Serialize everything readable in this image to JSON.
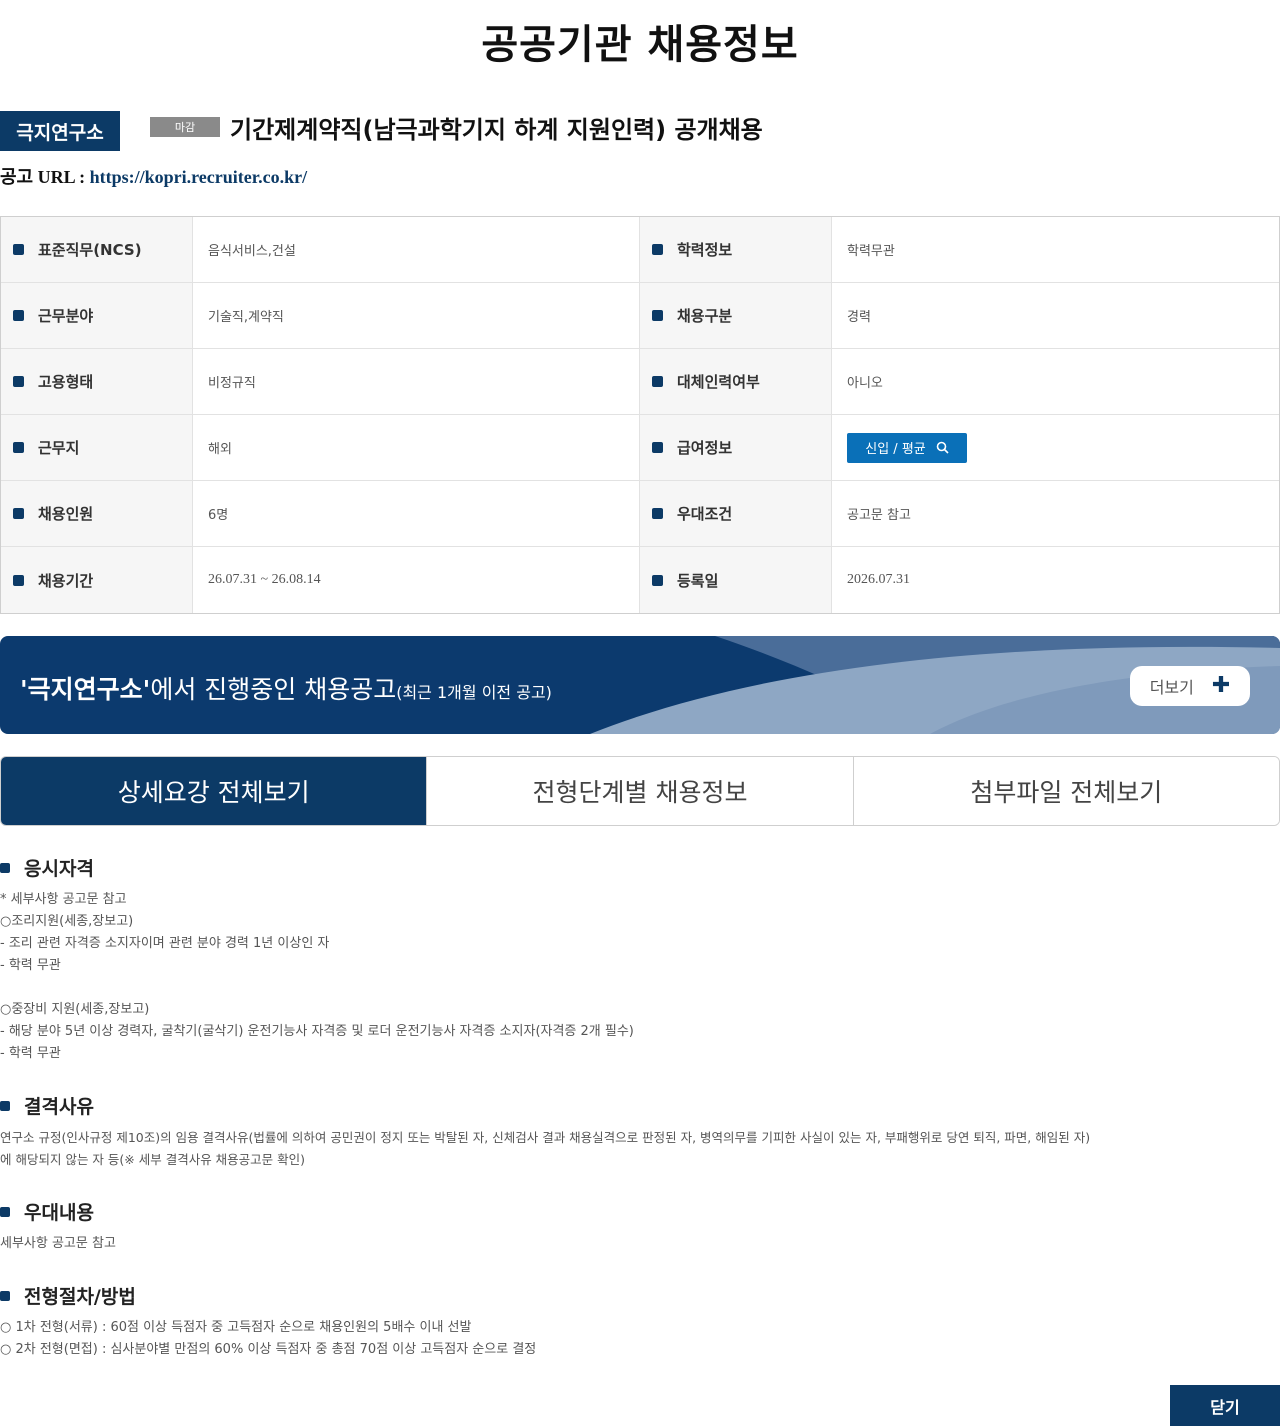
{
  "page": {
    "title": "공공기관 채용정보"
  },
  "posting": {
    "org": "극지연구소",
    "status_badge": "마감",
    "title": "기간제계약직(남극과학기지 하계 지원인력) 공개채용",
    "url_label": "공고 URL : ",
    "url": "https://kopri.recruiter.co.kr/"
  },
  "info": {
    "rows": [
      {
        "l_label": "표준직무(NCS)",
        "l_value": "음식서비스,건설",
        "r_label": "학력정보",
        "r_value": "학력무관"
      },
      {
        "l_label": "근무분야",
        "l_value": "기술직,계약직",
        "r_label": "채용구분",
        "r_value": "경력"
      },
      {
        "l_label": "고용형태",
        "l_value": "비정규직",
        "r_label": "대체인력여부",
        "r_value": "아니오"
      },
      {
        "l_label": "근무지",
        "l_value": "해외",
        "r_label": "급여정보",
        "r_value": ""
      },
      {
        "l_label": "채용인원",
        "l_value": "6명",
        "r_label": "우대조건",
        "r_value": "공고문 참고"
      },
      {
        "l_label": "채용기간",
        "l_value": "26.07.31 ~ 26.08.14",
        "r_label": "등록일",
        "r_value": "2026.07.31"
      }
    ],
    "salary_button": "신입 / 평균"
  },
  "banner": {
    "org_quoted": "'극지연구소'",
    "text": "에서 진행중인 채용공고",
    "small": "(최근 1개월 이전 공고)",
    "more_label": "더보기"
  },
  "tabs": [
    "상세요강 전체보기",
    "전형단계별 채용정보",
    "첨부파일 전체보기"
  ],
  "sections": {
    "qualification": {
      "title": "응시자격",
      "body": "* 세부사항 공고문 참고\n○조리지원(세종,장보고)\n- 조리 관련 자격증 소지자이며 관련 분야 경력 1년 이상인 자\n- 학력 무관\n\n○중장비 지원(세종,장보고)\n- 해당 분야 5년 이상 경력자, 굴착기(굴삭기) 운전기능사 자격증 및 로더 운전기능사 자격증 소지자(자격증 2개 필수)\n- 학력 무관"
    },
    "disqualification": {
      "title": "결격사유",
      "body": "연구소 규정(인사규정 제10조)의 임용 결격사유(법률에 의하여 공민권이 정지 또는 박탈된 자, 신체검사 결과 채용실격으로 판정된 자, 병역의무를 기피한 사실이 있는 자, 부패행위로 당연 퇴직, 파면, 해임된 자)\n에 해당되지 않는 자 등(※ 세부 결격사유 채용공고문 확인)"
    },
    "preference": {
      "title": "우대내용",
      "body": "세부사항 공고문 참고"
    },
    "procedure": {
      "title": "전형절차/방법",
      "body": "○ 1차 전형(서류) : 60점 이상 득점자 중 고득점자 순으로 채용인원의 5배수 이내 선발\n○ 2차 전형(면접) : 심사분야별 만점의 60% 이상 득점자 중 총점 70점 이상 고득점자 순으로 결정"
    }
  },
  "close_label": "닫기",
  "colors": {
    "primary": "#0c3a66",
    "accent": "#0a70b8",
    "badge_gray": "#8a8a8a"
  }
}
